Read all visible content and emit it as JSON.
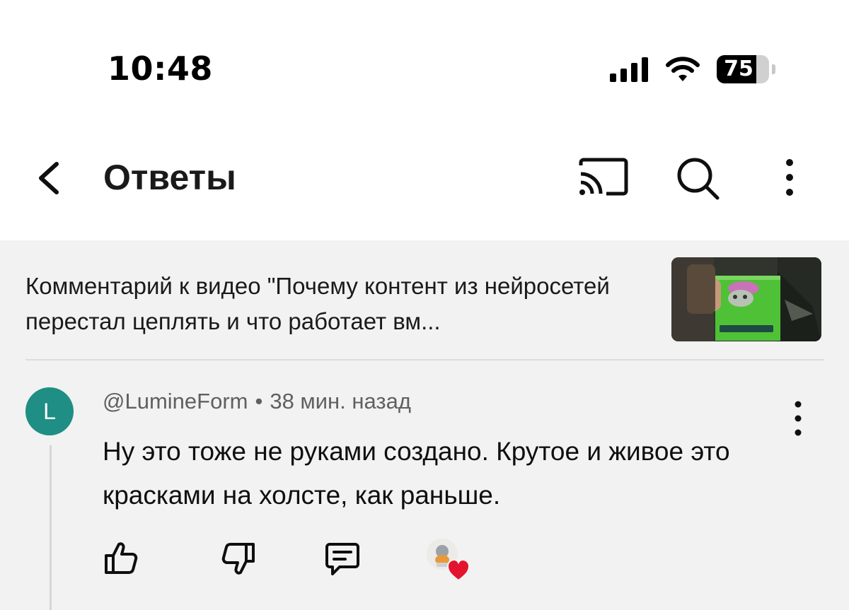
{
  "status_bar": {
    "time": "10:48",
    "battery_level": "75",
    "battery_fraction": 0.75,
    "icons": [
      "signal-icon",
      "wifi-icon",
      "battery-icon"
    ]
  },
  "header": {
    "title": "Ответы",
    "icons": [
      "back-chevron-icon",
      "cast-icon",
      "search-icon",
      "more-vertical-icon"
    ]
  },
  "video_context": {
    "text": "Комментарий к видео \"Почему контент из нейросетей перестал цеплять и что работает вм..."
  },
  "comment": {
    "avatar_letter": "L",
    "author": "@LumineForm",
    "separator": "•",
    "time_ago": "38 мин. назад",
    "text": "Ну это тоже не руками создано. Крутое и живое это красками на холсте, как раньше.",
    "actions": [
      "like-icon",
      "dislike-icon",
      "reply-icon",
      "creator-heart-icon"
    ]
  },
  "colors": {
    "avatar_bg": "#1f8e85",
    "content_bg": "#f2f2f2",
    "heart": "#e3142d",
    "meta_text": "#606060"
  }
}
